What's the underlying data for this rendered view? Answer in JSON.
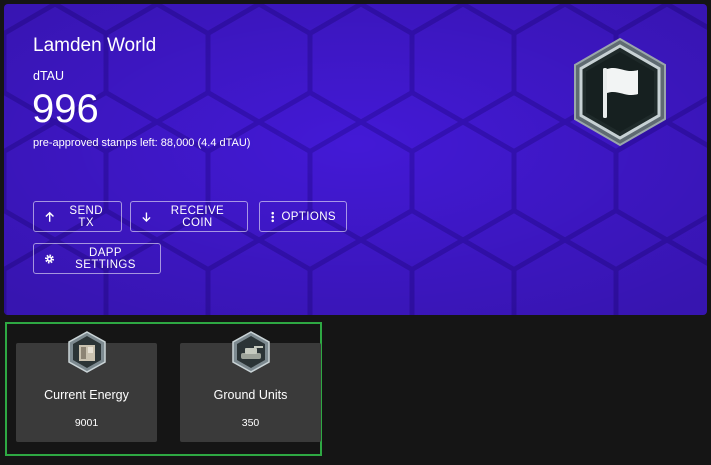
{
  "app": {
    "name": "Lamden World",
    "token_symbol": "dTAU",
    "balance": "996",
    "stamps_text": "pre-approved stamps left: 88,000 (4.4 dTAU)"
  },
  "buttons": {
    "send": "SEND TX",
    "receive": "RECEIVE COIN",
    "options": "OPTIONS",
    "dapp_settings": "DAPP SETTINGS"
  },
  "stats": [
    {
      "label": "Current Energy",
      "value": "9001",
      "icon": "energy-building-icon"
    },
    {
      "label": "Ground Units",
      "value": "350",
      "icon": "tank-icon"
    }
  ],
  "colors": {
    "card_bg": "#4319d6",
    "hex_line": "#3511b8",
    "page_bg": "#151515",
    "stat_bg": "#3a3a3a",
    "highlight_border": "#2ea843"
  },
  "icons": {
    "logo": "white-flag-hexagon-icon",
    "send": "arrow-up-icon",
    "receive": "arrow-down-icon",
    "options": "kebab-menu-icon",
    "dapp_settings": "gear-icon"
  }
}
